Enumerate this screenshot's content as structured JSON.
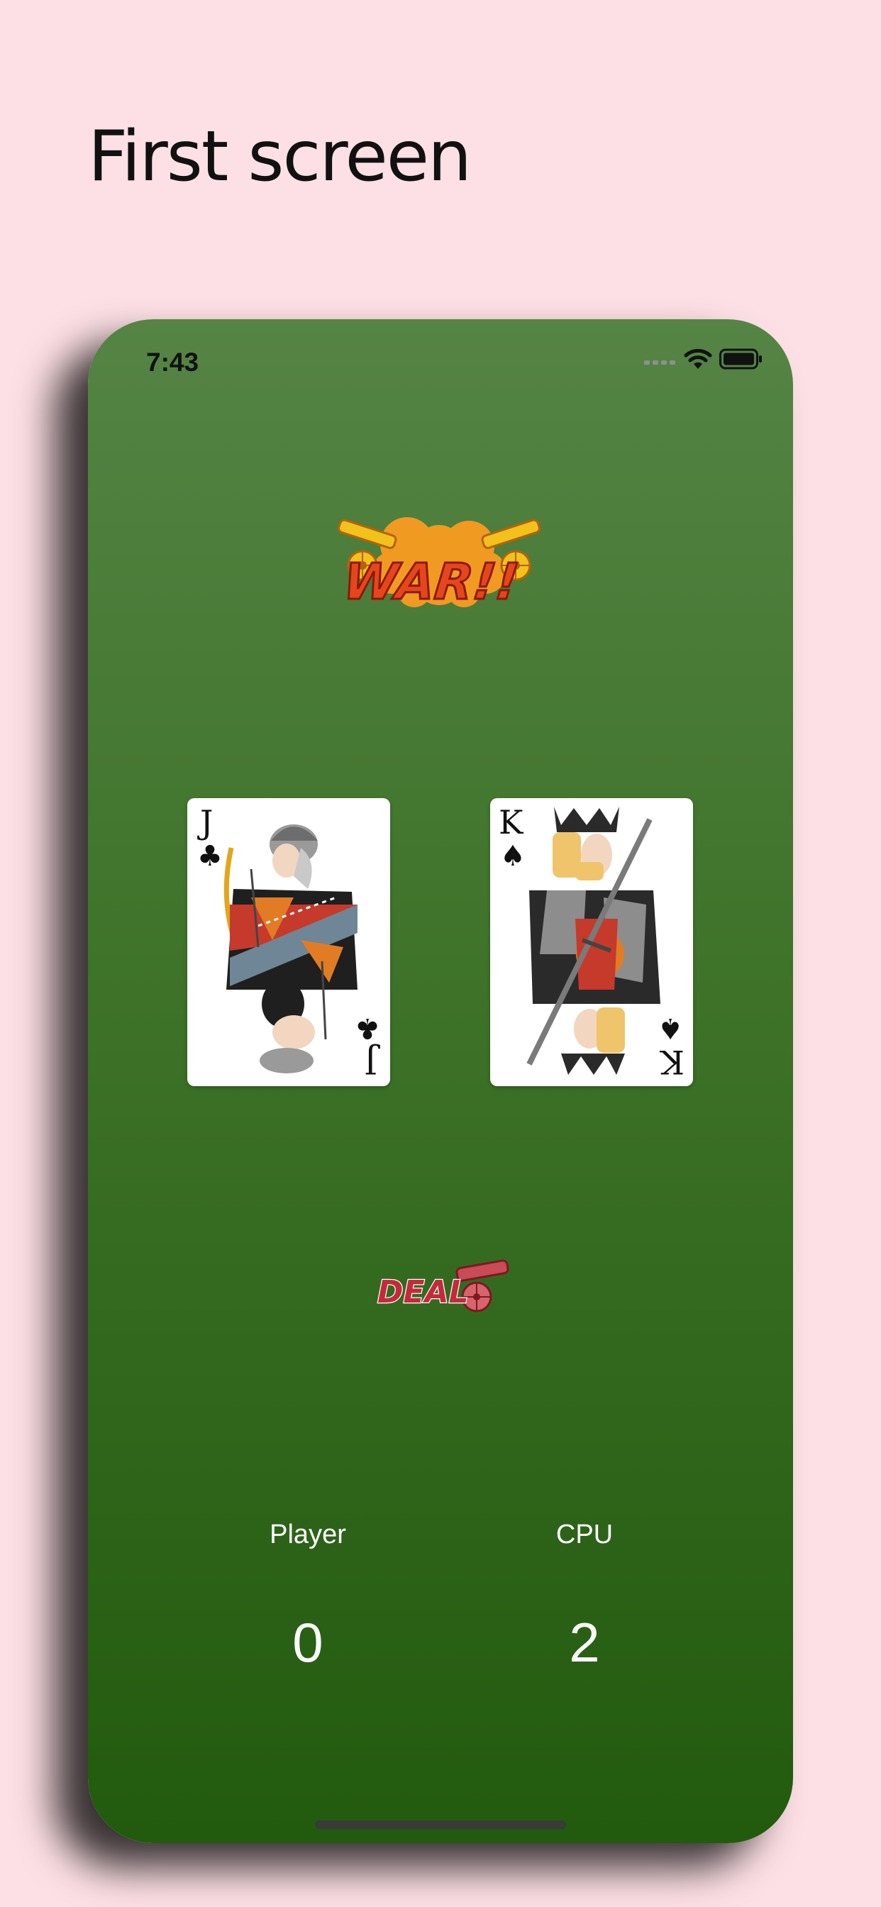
{
  "page": {
    "heading": "First screen",
    "background_color": "#fde0e5"
  },
  "status_bar": {
    "time": "7:43",
    "icons": [
      "cellular-signal-icon",
      "wifi-icon",
      "battery-icon"
    ]
  },
  "game": {
    "logo_text": "WAR!!",
    "player_card": {
      "rank": "J",
      "suit": "clubs",
      "suit_glyph": "♣"
    },
    "cpu_card": {
      "rank": "K",
      "suit": "spades",
      "suit_glyph": "♠"
    },
    "deal_button_text": "DEAL",
    "player_label": "Player",
    "cpu_label": "CPU",
    "player_score": "0",
    "cpu_score": "2",
    "felt_colors": [
      "#558445",
      "#225a0e"
    ]
  }
}
